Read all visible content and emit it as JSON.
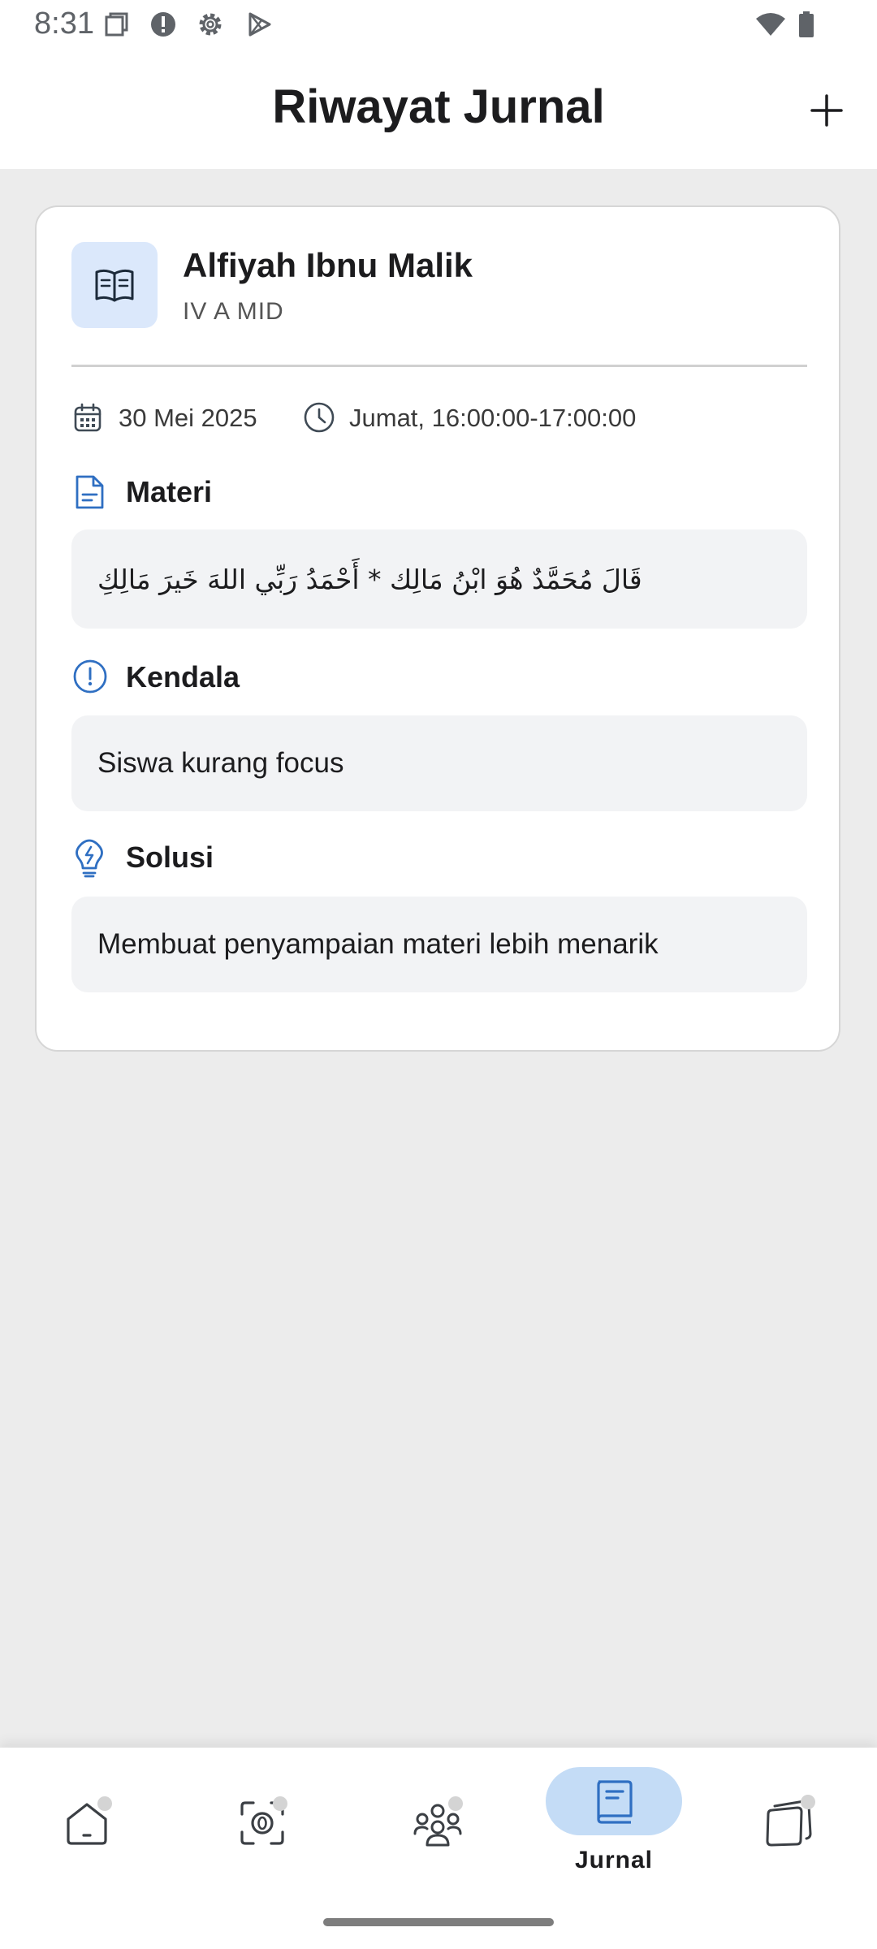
{
  "status_bar": {
    "time": "8:31"
  },
  "app_bar": {
    "title": "Riwayat Jurnal"
  },
  "journal_card": {
    "subject": "Alfiyah Ibnu Malik",
    "class_name": "IV A MID",
    "date": "30 Mei 2025",
    "schedule": "Jumat, 16:00:00-17:00:00",
    "sections": {
      "materi": {
        "title": "Materi",
        "content": "قَالَ مُحَمَّدٌ هُوَ ابْنُ مَالِك * أَحْمَدُ رَبِّي اللهَ خَيرَ مَالِكِ"
      },
      "kendala": {
        "title": "Kendala",
        "content": "Siswa kurang focus"
      },
      "solusi": {
        "title": "Solusi",
        "content": "Membuat penyampaian materi lebih menarik"
      }
    }
  },
  "bottom_nav": {
    "items": [
      {
        "icon": "home-icon",
        "label": ""
      },
      {
        "icon": "scan-icon",
        "label": ""
      },
      {
        "icon": "group-icon",
        "label": ""
      },
      {
        "icon": "journal-icon",
        "label": "Jurnal",
        "active": true
      },
      {
        "icon": "cards-icon",
        "label": ""
      }
    ]
  },
  "colors": {
    "accent": "#2f6fc2",
    "accent_light": "#c4dcf6",
    "icon_bg": "#dbe8fb",
    "box_bg": "#f2f3f5",
    "page_bg": "#ececec"
  }
}
